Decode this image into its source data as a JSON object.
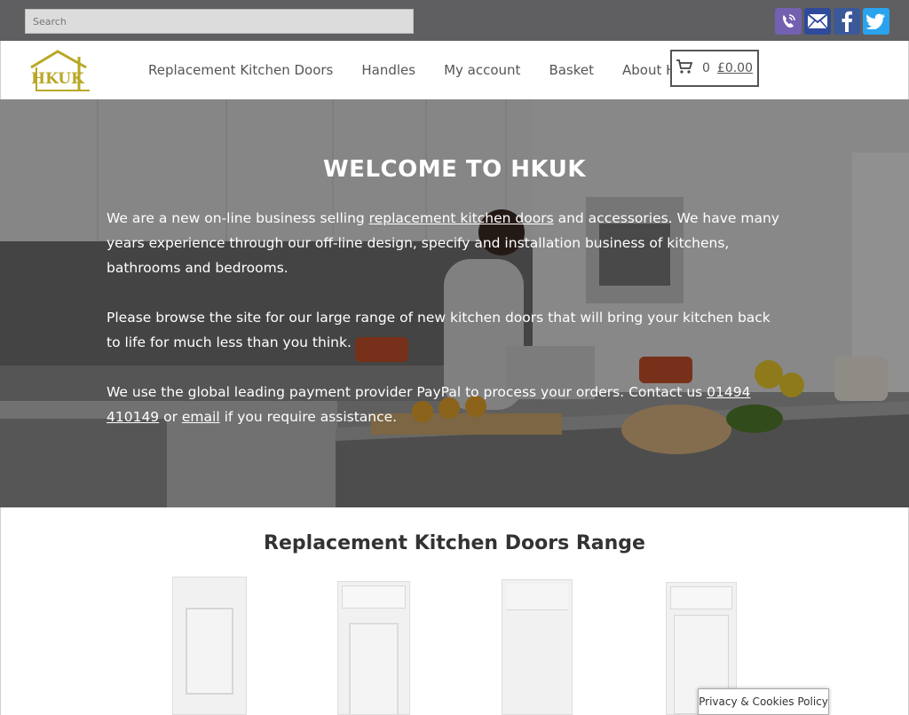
{
  "search": {
    "placeholder": "Search"
  },
  "social": [
    {
      "name": "viber-icon",
      "color": "#7360b0"
    },
    {
      "name": "email-icon",
      "color": "#2f4a9a"
    },
    {
      "name": "facebook-icon",
      "color": "#3b5998"
    },
    {
      "name": "twitter-icon",
      "color": "#2aa3ef"
    }
  ],
  "logo": {
    "text": "HKUK"
  },
  "nav": {
    "items": [
      {
        "label": "Replacement Kitchen Doors"
      },
      {
        "label": "Handles"
      },
      {
        "label": "My account"
      },
      {
        "label": "Basket"
      },
      {
        "label": "About HKUK"
      }
    ]
  },
  "cart": {
    "count": "0",
    "total": "£0.00"
  },
  "hero": {
    "title": "WELCOME TO HKUK",
    "p1_before": "We are a new on-line business selling ",
    "p1_link": "replacement kitchen doors",
    "p1_after": " and accessories. We have many years experience through our off-line design, specify and installation business of kitchens, bathrooms and bedrooms.",
    "p2": "Please browse the site for our large range of new kitchen doors that will bring your kitchen back to life for much less than you think.",
    "p3_before": "We use the global leading payment provider PayPal to process your orders. Contact us ",
    "p3_phone": "01494 410149",
    "p3_mid": " or ",
    "p3_email": "email",
    "p3_after": " if you require assistance."
  },
  "range": {
    "title": "Replacement Kitchen Doors Range"
  },
  "privacy": {
    "label": "Privacy & Cookies Policy"
  }
}
